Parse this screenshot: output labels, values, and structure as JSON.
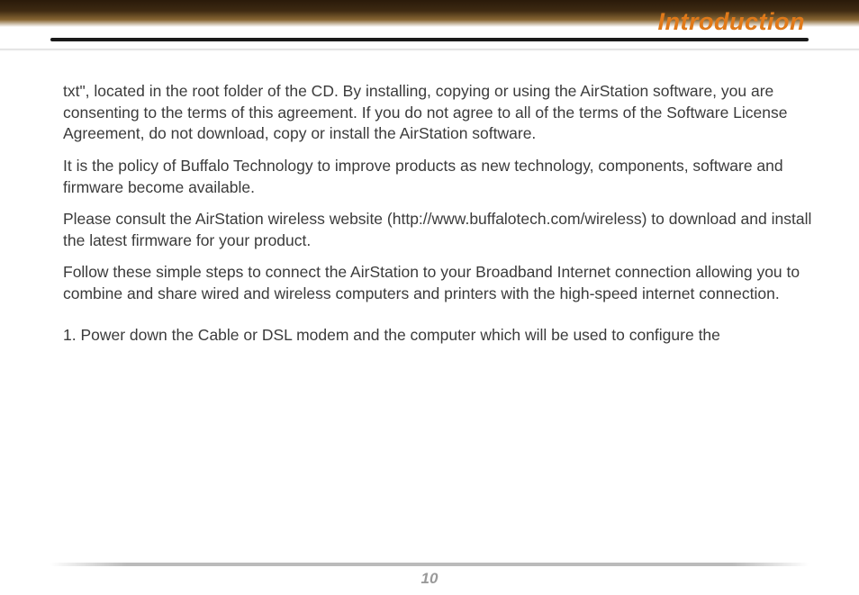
{
  "header": {
    "title": "Introduction"
  },
  "paragraphs": {
    "p1": "txt\", located in the root folder of the CD.  By installing, copying or using the AirStation software, you are consenting to the terms of this agreement. If you do not agree to all of the terms of the Software License Agreement, do not download, copy or install the AirStation software.",
    "p2": "It is the policy of Buffalo Technology to improve products as new technology, components, software and firmware become available.",
    "p3": "Please consult the AirStation wireless website (http://www.buffalotech.com/wireless) to download and install the latest firmware for your product.",
    "p4": "Follow these simple steps to connect the AirStation to your Broadband Internet connection allowing you to  combine and share wired and wireless computers and printers with the high-speed internet connection.",
    "step1": "1. Power down the Cable or DSL modem and the computer which will be used to configure the"
  },
  "footer": {
    "page_number": "10"
  }
}
